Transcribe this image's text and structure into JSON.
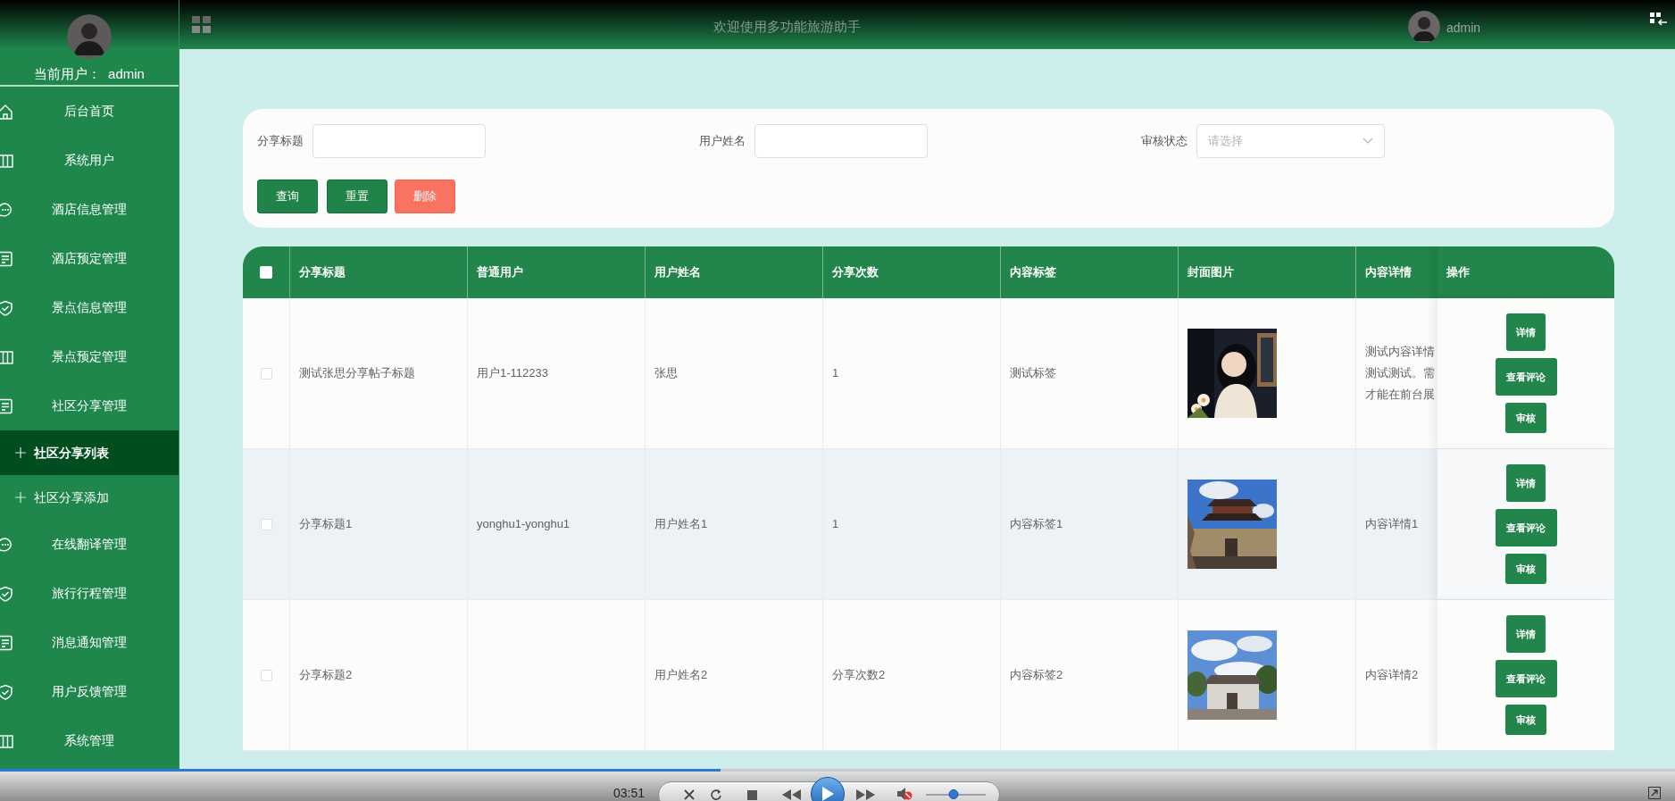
{
  "sidebar": {
    "current_user_label": "当前用户：",
    "current_user": "admin",
    "items": [
      {
        "label": "后台首页",
        "selected": false
      },
      {
        "label": "系统用户",
        "selected": false
      },
      {
        "label": "酒店信息管理",
        "selected": false
      },
      {
        "label": "酒店预定管理",
        "selected": false
      },
      {
        "label": "景点信息管理",
        "selected": false
      },
      {
        "label": "景点预定管理",
        "selected": false
      },
      {
        "label": "社区分享管理",
        "selected": false,
        "children": [
          {
            "label": "社区分享列表",
            "selected": true
          },
          {
            "label": "社区分享添加",
            "selected": false
          }
        ]
      },
      {
        "label": "在线翻译管理",
        "selected": false
      },
      {
        "label": "旅行行程管理",
        "selected": false
      },
      {
        "label": "消息通知管理",
        "selected": false
      },
      {
        "label": "用户反馈管理",
        "selected": false
      },
      {
        "label": "系统管理",
        "selected": false
      }
    ]
  },
  "header": {
    "title": "欢迎使用多功能旅游助手",
    "user": "admin"
  },
  "search": {
    "fields": [
      {
        "label": "分享标题",
        "kind": "input"
      },
      {
        "label": "用户姓名",
        "kind": "input"
      },
      {
        "label": "审核状态",
        "kind": "select",
        "placeholder": "请选择"
      }
    ],
    "buttons": [
      {
        "label": "查询",
        "kind": "primary"
      },
      {
        "label": "重置",
        "kind": "primary"
      },
      {
        "label": "删除",
        "kind": "danger"
      }
    ]
  },
  "table": {
    "select_all": {
      "checked": false
    },
    "columns": [
      "分享标题",
      "普通用户",
      "用户姓名",
      "分享次数",
      "内容标签",
      "封面图片",
      "内容详情",
      "操作"
    ],
    "rows": [
      {
        "checked": false,
        "title": "测试张思分享帖子标题",
        "user": "用户1-112233",
        "name": "张思",
        "count": "1",
        "tag": "测试标签",
        "cover": {
          "kind": "picture"
        },
        "detail": [
          "测试内容详情",
          "测试测试。需",
          "才能在前台展"
        ],
        "actions": [
          "详情",
          "查看评论",
          "审核"
        ],
        "highlighted": false
      },
      {
        "checked": false,
        "title": "分享标题1",
        "user": "yonghu1-yonghu1",
        "name": "用户姓名1",
        "count": "1",
        "tag": "内容标签1",
        "cover": {
          "kind": "picture"
        },
        "detail": [
          "内容详情1"
        ],
        "actions": [
          "详情",
          "查看评论",
          "审核"
        ],
        "highlighted": true
      },
      {
        "checked": false,
        "title": "分享标题2",
        "name": "用户姓名2",
        "count": "分享次数2",
        "tag": "内容标签2",
        "cover": {
          "kind": "picture"
        },
        "detail": [
          "内容详情2"
        ],
        "actions": [
          "详情",
          "查看评论",
          "审核"
        ],
        "highlighted": false
      }
    ]
  },
  "player": {
    "time": "03:51",
    "progress": {
      "level": 0.43
    },
    "volume": {
      "level": 0.47
    }
  }
}
